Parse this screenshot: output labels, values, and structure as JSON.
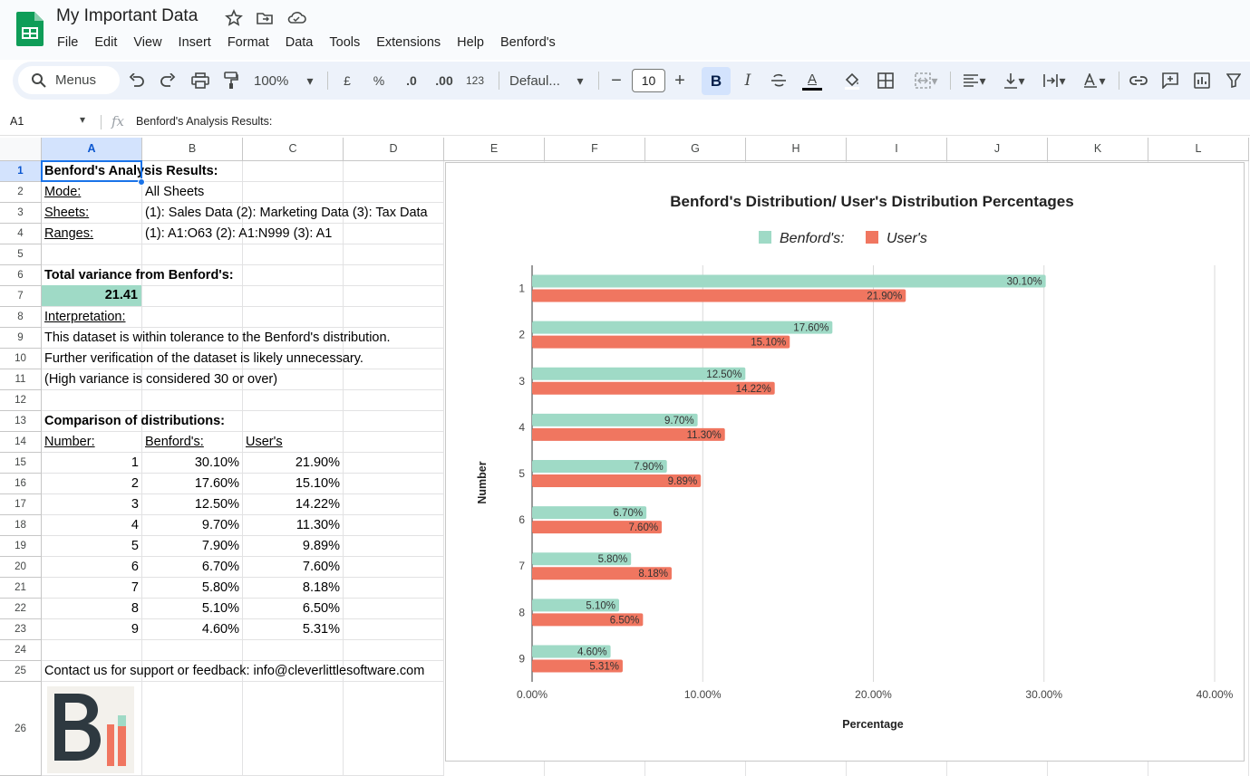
{
  "app": {
    "title": "My Important Data"
  },
  "menu": [
    "File",
    "Edit",
    "View",
    "Insert",
    "Format",
    "Data",
    "Tools",
    "Extensions",
    "Help",
    "Benford's"
  ],
  "toolbar": {
    "search": "Menus",
    "zoom": "100%",
    "currency": "£",
    "percent": "%",
    "dec_less": ".0",
    "dec_more": ".00",
    "number_format": "123",
    "font": "Defaul...",
    "font_size": "10",
    "bold": "B",
    "italic": "I",
    "text_color_letter": "A"
  },
  "formula_bar": {
    "name_box": "A1",
    "fx": "fx",
    "content": "Benford's Analysis Results:"
  },
  "columns": [
    "A",
    "B",
    "C",
    "D",
    "E",
    "F",
    "G",
    "H",
    "I",
    "J",
    "K",
    "L"
  ],
  "rows": [
    "1",
    "2",
    "3",
    "4",
    "5",
    "6",
    "7",
    "8",
    "9",
    "10",
    "11",
    "12",
    "13",
    "14",
    "15",
    "16",
    "17",
    "18",
    "19",
    "20",
    "21",
    "22",
    "23",
    "24",
    "25",
    "26"
  ],
  "sheet": {
    "r1": "Benford's Analysis Results:",
    "mode_label": "Mode:",
    "mode_value": "All Sheets",
    "sheets_label": "Sheets:",
    "sheets_value": "(1): Sales Data (2): Marketing Data (3): Tax Data",
    "ranges_label": "Ranges:",
    "ranges_value": "(1): A1:O63 (2): A1:N999 (3): A1",
    "variance_label": "Total variance from Benford's:",
    "variance_value": "21.41",
    "interp_label": "Interpretation:",
    "interp1": "This dataset is within tolerance to the Benford's distribution.",
    "interp2": "Further verification of the dataset is likely unnecessary.",
    "interp3": "(High variance is considered 30 or over)",
    "comparison_label": "Comparison of distributions:",
    "hdr_number": "Number:",
    "hdr_benford": "Benford's:",
    "hdr_user": "User's",
    "table": [
      [
        "1",
        "30.10%",
        "21.90%"
      ],
      [
        "2",
        "17.60%",
        "15.10%"
      ],
      [
        "3",
        "12.50%",
        "14.22%"
      ],
      [
        "4",
        "9.70%",
        "11.30%"
      ],
      [
        "5",
        "7.90%",
        "9.89%"
      ],
      [
        "6",
        "6.70%",
        "7.60%"
      ],
      [
        "7",
        "5.80%",
        "8.18%"
      ],
      [
        "8",
        "5.10%",
        "6.50%"
      ],
      [
        "9",
        "4.60%",
        "5.31%"
      ]
    ],
    "contact": "Contact us for support or feedback: info@cleverlittlesoftware.com"
  },
  "colors": {
    "benford": "#9fdac6",
    "user": "#f07660",
    "accent": "#0b57d0"
  },
  "chart_data": {
    "type": "bar",
    "orientation": "horizontal",
    "title": "Benford's Distribution/ User's Distribution Percentages",
    "xlabel": "Percentage",
    "ylabel": "Number",
    "categories": [
      "1",
      "2",
      "3",
      "4",
      "5",
      "6",
      "7",
      "8",
      "9"
    ],
    "series": [
      {
        "name": "Benford's:",
        "values": [
          30.1,
          17.6,
          12.5,
          9.7,
          7.9,
          6.7,
          5.8,
          5.1,
          4.6
        ],
        "labels": [
          "30.10%",
          "17.60%",
          "12.50%",
          "9.70%",
          "7.90%",
          "6.70%",
          "5.80%",
          "5.10%",
          "4.60%"
        ]
      },
      {
        "name": "User's",
        "values": [
          21.9,
          15.1,
          14.22,
          11.3,
          9.89,
          7.6,
          8.18,
          6.5,
          5.31
        ],
        "labels": [
          "21.90%",
          "15.10%",
          "14.22%",
          "11.30%",
          "9.89%",
          "7.60%",
          "8.18%",
          "6.50%",
          "5.31%"
        ]
      }
    ],
    "xlim": [
      0,
      40
    ],
    "xticks": [
      "0.00%",
      "10.00%",
      "20.00%",
      "30.00%",
      "40.00%"
    ],
    "legend": "top",
    "grid": true
  }
}
